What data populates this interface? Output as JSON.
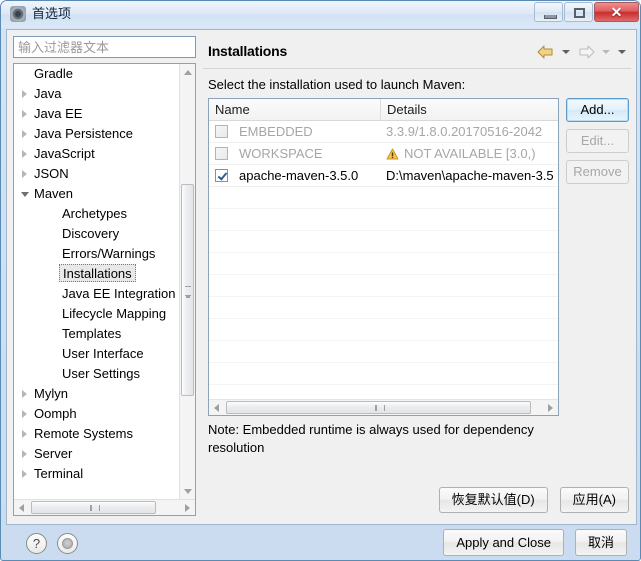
{
  "window": {
    "title": "首选项",
    "icon": "preferences-gear-icon",
    "controls": {
      "minimize": "minimize-icon",
      "maximize": "restore-icon",
      "close": "✕"
    }
  },
  "sidebar": {
    "filter_placeholder": "输入过滤器文本",
    "tree": [
      {
        "label": "Gradle",
        "depth": 1,
        "arrow": "none"
      },
      {
        "label": "Java",
        "depth": 1,
        "arrow": "collapsed"
      },
      {
        "label": "Java EE",
        "depth": 1,
        "arrow": "collapsed"
      },
      {
        "label": "Java Persistence",
        "depth": 1,
        "arrow": "collapsed"
      },
      {
        "label": "JavaScript",
        "depth": 1,
        "arrow": "collapsed"
      },
      {
        "label": "JSON",
        "depth": 1,
        "arrow": "collapsed"
      },
      {
        "label": "Maven",
        "depth": 1,
        "arrow": "expanded"
      },
      {
        "label": "Archetypes",
        "depth": 2,
        "arrow": "none"
      },
      {
        "label": "Discovery",
        "depth": 2,
        "arrow": "none"
      },
      {
        "label": "Errors/Warnings",
        "depth": 2,
        "arrow": "none"
      },
      {
        "label": "Installations",
        "depth": 2,
        "arrow": "none",
        "selected": true
      },
      {
        "label": "Java EE Integration",
        "depth": 2,
        "arrow": "none"
      },
      {
        "label": "Lifecycle Mapping",
        "depth": 2,
        "arrow": "none"
      },
      {
        "label": "Templates",
        "depth": 2,
        "arrow": "none"
      },
      {
        "label": "User Interface",
        "depth": 2,
        "arrow": "none"
      },
      {
        "label": "User Settings",
        "depth": 2,
        "arrow": "none"
      },
      {
        "label": "Mylyn",
        "depth": 1,
        "arrow": "collapsed"
      },
      {
        "label": "Oomph",
        "depth": 1,
        "arrow": "collapsed"
      },
      {
        "label": "Remote Systems",
        "depth": 1,
        "arrow": "collapsed"
      },
      {
        "label": "Server",
        "depth": 1,
        "arrow": "collapsed"
      },
      {
        "label": "Terminal",
        "depth": 1,
        "arrow": "collapsed"
      }
    ]
  },
  "main": {
    "page_title": "Installations",
    "instruction": "Select the installation used to launch Maven:",
    "nav": {
      "back_icon": "back-arrow-icon",
      "back_menu_icon": "chevron-down-icon",
      "forward_icon": "forward-arrow-icon",
      "forward_menu_icon": "chevron-down-icon",
      "view_menu_icon": "chevron-down-icon"
    },
    "table": {
      "columns": [
        "Name",
        "Details"
      ],
      "rows": [
        {
          "checked": false,
          "enabled": false,
          "name": "EMBEDDED",
          "details": "3.3.9/1.8.0.20170516-2042",
          "warning": false
        },
        {
          "checked": false,
          "enabled": false,
          "name": "WORKSPACE",
          "details": "NOT AVAILABLE [3.0,)",
          "warning": true
        },
        {
          "checked": true,
          "enabled": true,
          "name": "apache-maven-3.5.0",
          "details": "D:\\maven\\apache-maven-3.5",
          "warning": false
        }
      ]
    },
    "side_buttons": [
      {
        "label": "Add...",
        "state": "focused"
      },
      {
        "label": "Edit...",
        "state": "disabled"
      },
      {
        "label": "Remove",
        "state": "disabled"
      }
    ],
    "note": "Note: Embedded runtime is always used for dependency resolution",
    "page_buttons": [
      {
        "label": "恢复默认值(D)"
      },
      {
        "label": "应用(A)"
      }
    ]
  },
  "footer": {
    "help_icon": "?",
    "pin_icon": "oomph-record-icon",
    "buttons": [
      {
        "label": "Apply and Close"
      },
      {
        "label": "取消"
      }
    ]
  }
}
